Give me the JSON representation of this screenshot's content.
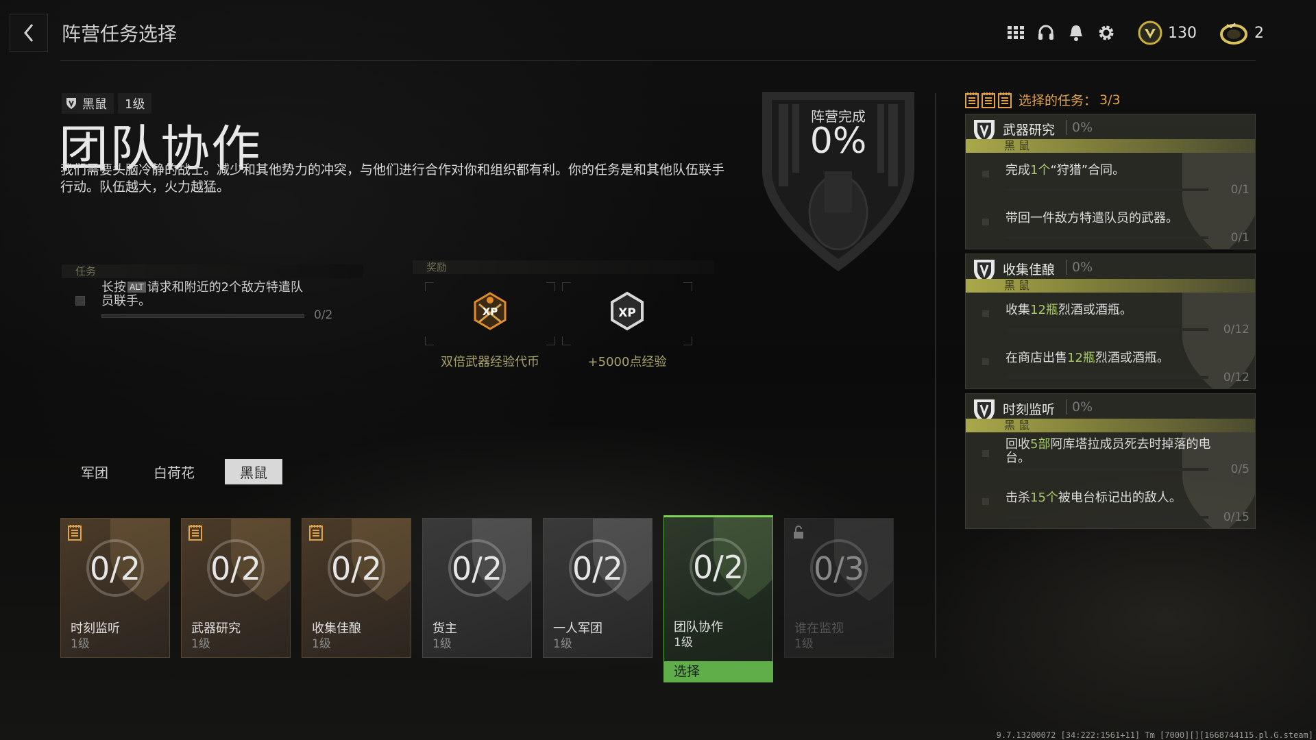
{
  "header": {
    "title": "阵营任务选择",
    "currency_a": "130",
    "currency_b": "2"
  },
  "mission": {
    "faction": "黑鼠",
    "level": "1级",
    "title": "团队协作",
    "description": "我们需要头脑冷静的战士。减少和其他势力的冲突，与他们进行合作对你和组织都有利。你的任务是和其他队伍联手行动。队伍越大，火力越猛。",
    "completion_label": "阵营完成",
    "completion_value": "0%"
  },
  "tasks": {
    "section_label": "任务",
    "items": [
      {
        "prefix": "长按",
        "key": "ALT",
        "text": "请求和附近的2个敌方特遣队员联手。",
        "count": "0/2",
        "progress": 0
      }
    ]
  },
  "rewards": {
    "section_label": "奖励",
    "items": [
      {
        "label": "双倍武器经验代币",
        "icon": "double-weapon-xp-token-icon"
      },
      {
        "label": "+5000点经验",
        "icon": "xp-hexagon-icon"
      }
    ]
  },
  "faction_tabs": [
    {
      "label": "军团",
      "active": false
    },
    {
      "label": "白荷花",
      "active": false
    },
    {
      "label": "黑鼠",
      "active": true
    }
  ],
  "cards": [
    {
      "progress": "0/2",
      "name": "时刻监听",
      "level": "1级",
      "style": "orange",
      "badge": "note"
    },
    {
      "progress": "0/2",
      "name": "武器研究",
      "level": "1级",
      "style": "orange",
      "badge": "note"
    },
    {
      "progress": "0/2",
      "name": "收集佳酿",
      "level": "1级",
      "style": "orange",
      "badge": "note"
    },
    {
      "progress": "0/2",
      "name": "货主",
      "level": "1级",
      "style": "grey",
      "badge": ""
    },
    {
      "progress": "0/2",
      "name": "一人军团",
      "level": "1级",
      "style": "grey",
      "badge": ""
    },
    {
      "progress": "0/2",
      "name": "团队协作",
      "level": "1级",
      "style": "selected",
      "badge": "",
      "select_label": "选择"
    },
    {
      "progress": "0/3",
      "name": "谁在监视",
      "level": "1级",
      "style": "locked",
      "badge": "lock"
    }
  ],
  "selected_panel": {
    "header_label": "选择的任务：",
    "header_count": "3/3",
    "missions": [
      {
        "title": "武器研究",
        "pct": "0%",
        "faction": "黑 鼠",
        "objectives": [
          {
            "parts": [
              "完成",
              "1个",
              "“狩猎”合同。"
            ],
            "count": "0/1"
          },
          {
            "parts": [
              "带回一件敌方特遣队员的武器。",
              "",
              ""
            ],
            "count": "0/1"
          }
        ]
      },
      {
        "title": "收集佳酿",
        "pct": "0%",
        "faction": "黑 鼠",
        "objectives": [
          {
            "parts": [
              "收集",
              "12瓶",
              "烈酒或酒瓶。"
            ],
            "count": "0/12"
          },
          {
            "parts": [
              "在商店出售",
              "12瓶",
              "烈酒或酒瓶。"
            ],
            "count": "0/12"
          }
        ]
      },
      {
        "title": "时刻监听",
        "pct": "0%",
        "faction": "黑 鼠",
        "objectives": [
          {
            "parts": [
              "回收",
              "5部",
              "阿库塔拉成员死去时掉落的电台。"
            ],
            "count": "0/5"
          },
          {
            "parts": [
              "击杀",
              "15个",
              "被电台标记出的敌人。"
            ],
            "count": "0/15"
          }
        ]
      }
    ]
  },
  "build_info": "9.7.13200072 [34:222:1561+11] Tm [7000][][1668744115.pl.G.steam]",
  "colors": {
    "accent_gold": "#e2a446",
    "select_green": "#5fae4a",
    "faction_bar": "#a9a84a",
    "highlight_green": "#a8c96a"
  }
}
